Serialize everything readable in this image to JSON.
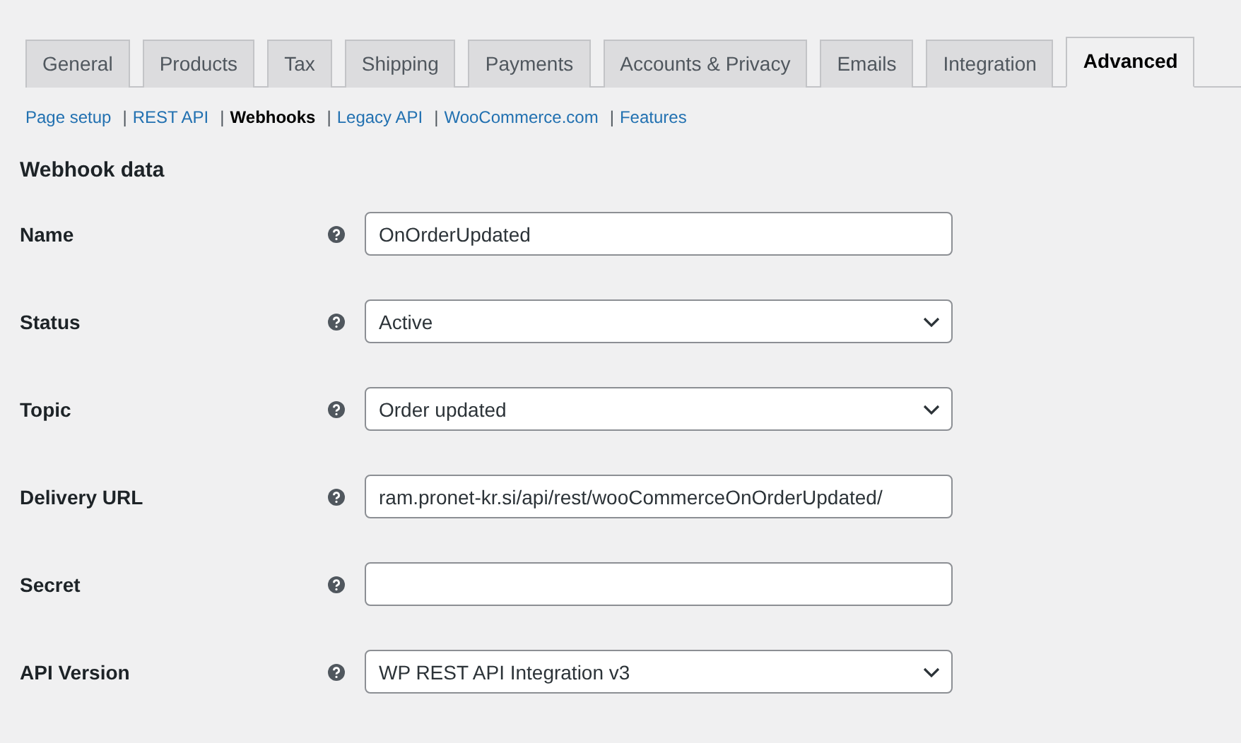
{
  "tabs": [
    {
      "label": "General",
      "selected": false
    },
    {
      "label": "Products",
      "selected": false
    },
    {
      "label": "Tax",
      "selected": false
    },
    {
      "label": "Shipping",
      "selected": false
    },
    {
      "label": "Payments",
      "selected": false
    },
    {
      "label": "Accounts & Privacy",
      "selected": false
    },
    {
      "label": "Emails",
      "selected": false
    },
    {
      "label": "Integration",
      "selected": false
    },
    {
      "label": "Advanced",
      "selected": true
    }
  ],
  "subnav": {
    "separator": "|",
    "links": [
      {
        "label": "Page setup",
        "selected": false
      },
      {
        "label": "REST API",
        "selected": false
      },
      {
        "label": "Webhooks",
        "selected": true
      },
      {
        "label": "Legacy API",
        "selected": false
      },
      {
        "label": "WooCommerce.com",
        "selected": false
      },
      {
        "label": "Features",
        "selected": false
      }
    ]
  },
  "section_title": "Webhook data",
  "fields": [
    {
      "label": "Name",
      "kind": "text",
      "value": "OnOrderUpdated"
    },
    {
      "label": "Status",
      "kind": "select",
      "value": "Active"
    },
    {
      "label": "Topic",
      "kind": "select",
      "value": "Order updated"
    },
    {
      "label": "Delivery URL",
      "kind": "text",
      "value": "ram.pronet-kr.si/api/rest/wooCommerceOnOrderUpdated/"
    },
    {
      "label": "Secret",
      "kind": "text"
    },
    {
      "label": "API Version",
      "kind": "select",
      "value": "WP REST API Integration v3"
    }
  ]
}
